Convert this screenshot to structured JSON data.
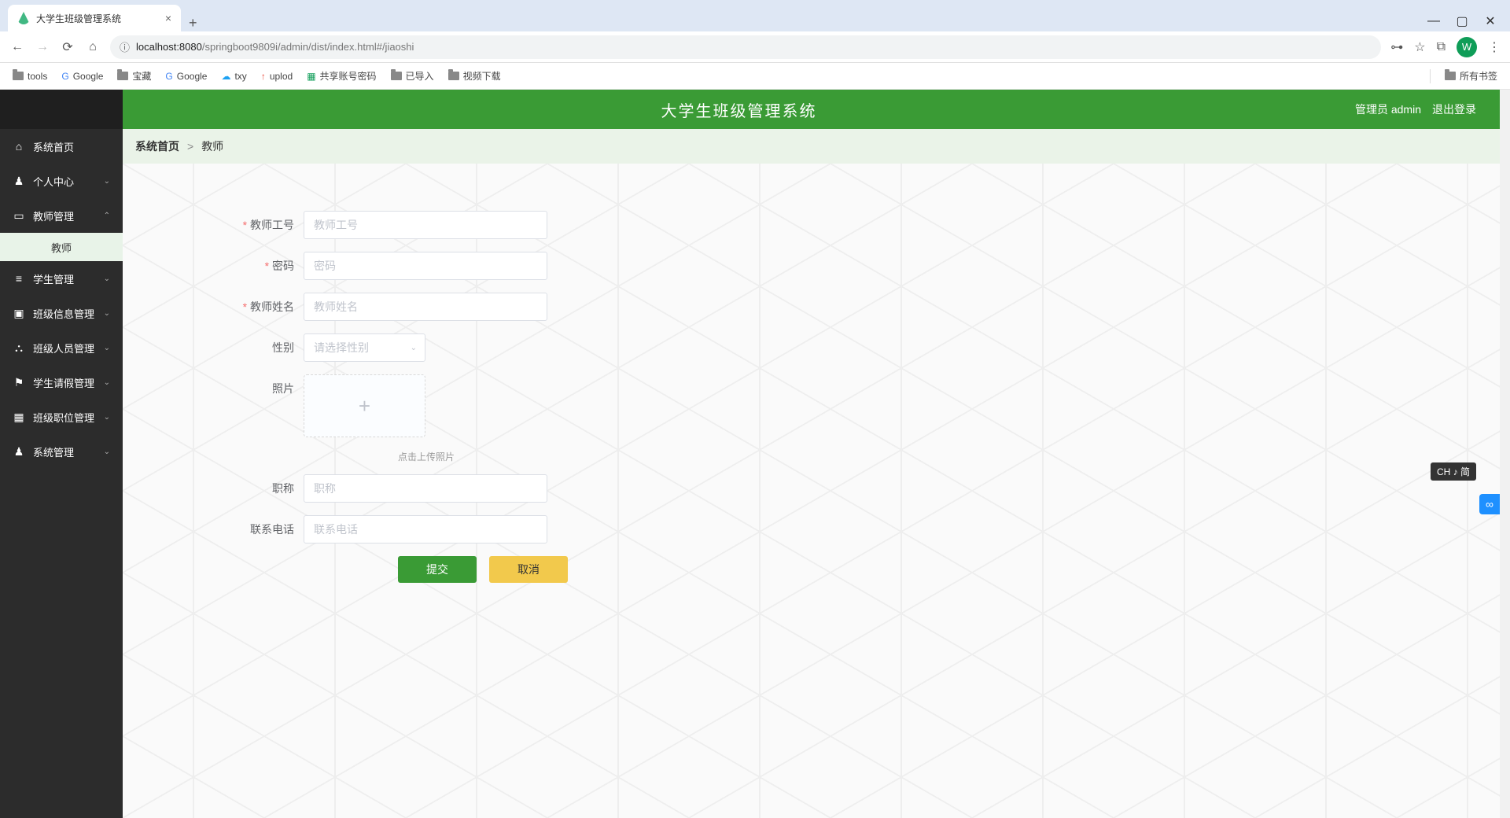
{
  "browser": {
    "tab_title": "大学生班级管理系统",
    "url_host": "localhost:8080",
    "url_path": "/springboot9809i/admin/dist/index.html#/jiaoshi",
    "bookmarks": [
      "tools",
      "Google",
      "宝藏",
      "Google",
      "txy",
      "uplod",
      "共享账号密码",
      "已导入",
      "视频下载"
    ],
    "all_bookmarks": "所有书签",
    "avatar_letter": "W"
  },
  "app": {
    "title": "大学生班级管理系统",
    "user_label": "管理员 admin",
    "logout": "退出登录"
  },
  "sidebar": {
    "items": [
      {
        "icon": "home",
        "label": "系统首页",
        "chevron": false
      },
      {
        "icon": "user",
        "label": "个人中心",
        "chevron": true
      },
      {
        "icon": "card",
        "label": "教师管理",
        "chevron": true,
        "open": true,
        "sub": [
          {
            "label": "教师"
          }
        ]
      },
      {
        "icon": "list",
        "label": "学生管理",
        "chevron": true
      },
      {
        "icon": "monitor",
        "label": "班级信息管理",
        "chevron": true
      },
      {
        "icon": "people",
        "label": "班级人员管理",
        "chevron": true
      },
      {
        "icon": "flag",
        "label": "学生请假管理",
        "chevron": true
      },
      {
        "icon": "grid",
        "label": "班级职位管理",
        "chevron": true
      },
      {
        "icon": "user",
        "label": "系统管理",
        "chevron": true
      }
    ]
  },
  "breadcrumb": {
    "home": "系统首页",
    "sep": ">",
    "current": "教师"
  },
  "form": {
    "fields": {
      "teacher_id": {
        "label": "教师工号",
        "placeholder": "教师工号"
      },
      "password": {
        "label": "密码",
        "placeholder": "密码"
      },
      "teacher_name": {
        "label": "教师姓名",
        "placeholder": "教师姓名"
      },
      "gender": {
        "label": "性别",
        "placeholder": "请选择性别"
      },
      "photo": {
        "label": "照片",
        "hint": "点击上传照片"
      },
      "title": {
        "label": "职称",
        "placeholder": "职称"
      },
      "phone": {
        "label": "联系电话",
        "placeholder": "联系电话"
      }
    },
    "submit": "提交",
    "cancel": "取消"
  },
  "ime": "CH ♪ 简"
}
